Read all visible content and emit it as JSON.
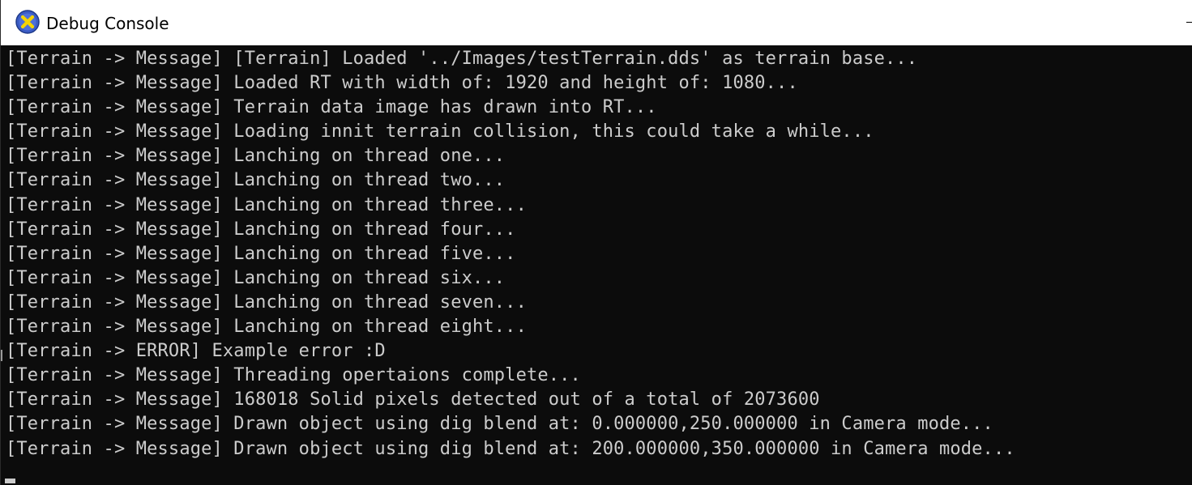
{
  "window": {
    "title": "Debug Console",
    "colors": {
      "titlebar_bg": "#ffffff",
      "console_bg": "#0c0c0c",
      "console_text": "#cccccc",
      "icon_bg": "#3b5cc4",
      "icon_mark": "#f5d400"
    },
    "icon": "app-x-icon"
  },
  "console": {
    "lines": [
      "[Terrain -> Message] [Terrain] Loaded '../Images/testTerrain.dds' as terrain base...",
      "[Terrain -> Message] Loaded RT with width of: 1920 and height of: 1080...",
      "[Terrain -> Message] Terrain data image has drawn into RT...",
      "[Terrain -> Message] Loading innit terrain collision, this could take a while...",
      "[Terrain -> Message] Lanching on thread one...",
      "[Terrain -> Message] Lanching on thread two...",
      "[Terrain -> Message] Lanching on thread three...",
      "[Terrain -> Message] Lanching on thread four...",
      "[Terrain -> Message] Lanching on thread five...",
      "[Terrain -> Message] Lanching on thread six...",
      "[Terrain -> Message] Lanching on thread seven...",
      "[Terrain -> Message] Lanching on thread eight...",
      "[Terrain -> ERROR] Example error :D",
      "[Terrain -> Message] Threading opertaions complete...",
      "[Terrain -> Message] 168018 Solid pixels detected out of a total of 2073600",
      "[Terrain -> Message] Drawn object using dig blend at: 0.000000,250.000000 in Camera mode...",
      "[Terrain -> Message] Drawn object using dig blend at: 200.000000,350.000000 in Camera mode..."
    ]
  }
}
